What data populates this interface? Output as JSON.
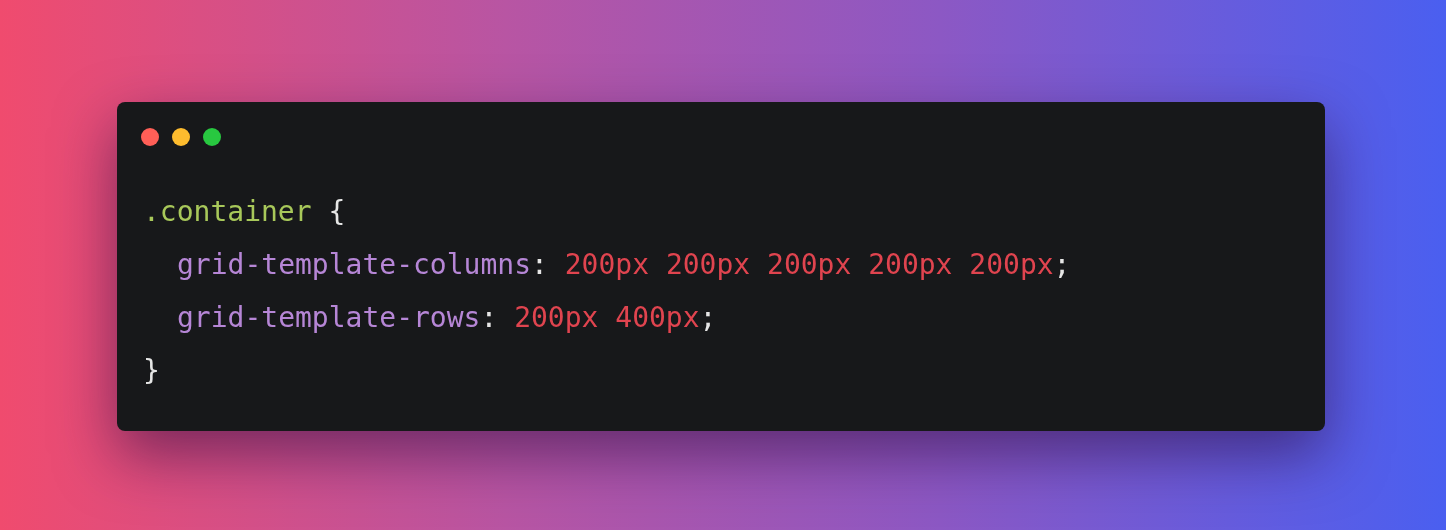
{
  "window_controls": [
    {
      "color": "#ff5f57"
    },
    {
      "color": "#febc2e"
    },
    {
      "color": "#28c840"
    }
  ],
  "css_rule": {
    "selector": ".container",
    "open_brace": "{",
    "declarations": [
      {
        "property": "grid-template-columns",
        "colon": ":",
        "value": "200px 200px 200px 200px 200px",
        "semicolon": ";"
      },
      {
        "property": "grid-template-rows",
        "colon": ":",
        "value": "200px 400px",
        "semicolon": ";"
      }
    ],
    "close_brace": "}"
  }
}
